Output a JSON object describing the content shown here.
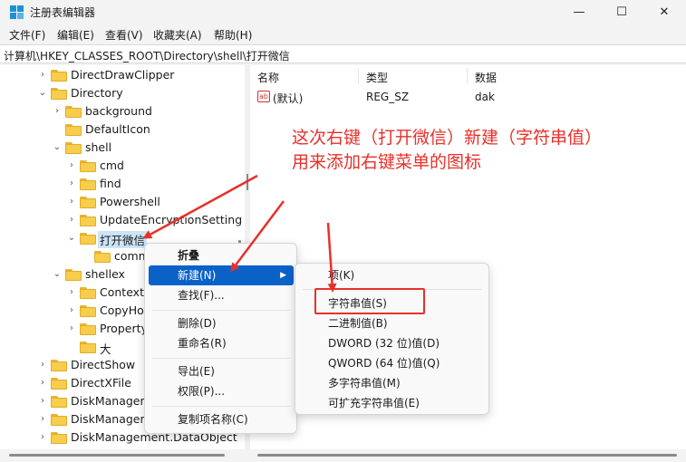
{
  "window": {
    "title": "注册表编辑器",
    "controls": [
      "—",
      "☐",
      "✕"
    ]
  },
  "menubar": [
    "文件(F)",
    "编辑(E)",
    "查看(V)",
    "收藏夹(A)",
    "帮助(H)"
  ],
  "address": "计算机\\HKEY_CLASSES_ROOT\\Directory\\shell\\打开微信",
  "tree": [
    {
      "label": "DirectDrawClipper",
      "chev": "›"
    },
    {
      "label": "Directory",
      "chev": "⌄"
    },
    {
      "label": "background",
      "chev": "›"
    },
    {
      "label": "DefaultIcon",
      "chev": ""
    },
    {
      "label": "shell",
      "chev": "⌄"
    },
    {
      "label": "cmd",
      "chev": "›"
    },
    {
      "label": "find",
      "chev": "›"
    },
    {
      "label": "Powershell",
      "chev": "›"
    },
    {
      "label": "UpdateEncryptionSetting",
      "chev": "›"
    },
    {
      "label": "打开微信",
      "chev": "⌄"
    },
    {
      "label": "comm",
      "chev": ""
    },
    {
      "label": "shellex",
      "chev": "⌄"
    },
    {
      "label": "ContextM",
      "chev": "›"
    },
    {
      "label": "CopyHo",
      "chev": "›"
    },
    {
      "label": "Property",
      "chev": "›"
    },
    {
      "label": "大",
      "chev": ""
    },
    {
      "label": "DirectShow",
      "chev": "›"
    },
    {
      "label": "DirectXFile",
      "chev": "›"
    },
    {
      "label": "DiskManagem",
      "chev": "›"
    },
    {
      "label": "DiskManagem",
      "chev": "›"
    },
    {
      "label": "DiskManagement.DataObject",
      "chev": "›"
    }
  ],
  "list": {
    "headers": {
      "name": "名称",
      "type": "类型",
      "data": "数据"
    },
    "rows": [
      {
        "icon": "ab",
        "name": "(默认)",
        "type": "REG_SZ",
        "data": "dak"
      }
    ]
  },
  "annotation": {
    "line1": "这次右键（打开微信）新建（字符串值）",
    "line2": "用来添加右键菜单的图标",
    "color": "#e8302a"
  },
  "context_menu": {
    "items": [
      "折叠",
      "新建(N)",
      "查找(F)...",
      "删除(D)",
      "重命名(R)",
      "导出(E)",
      "权限(P)...",
      "复制项名称(C)"
    ]
  },
  "submenu": {
    "items": [
      "项(K)",
      "字符串值(S)",
      "二进制值(B)",
      "DWORD (32 位)值(D)",
      "QWORD (64 位)值(Q)",
      "多字符串值(M)",
      "可扩充字符串值(E)"
    ],
    "highlighted": "字符串值(S)"
  }
}
